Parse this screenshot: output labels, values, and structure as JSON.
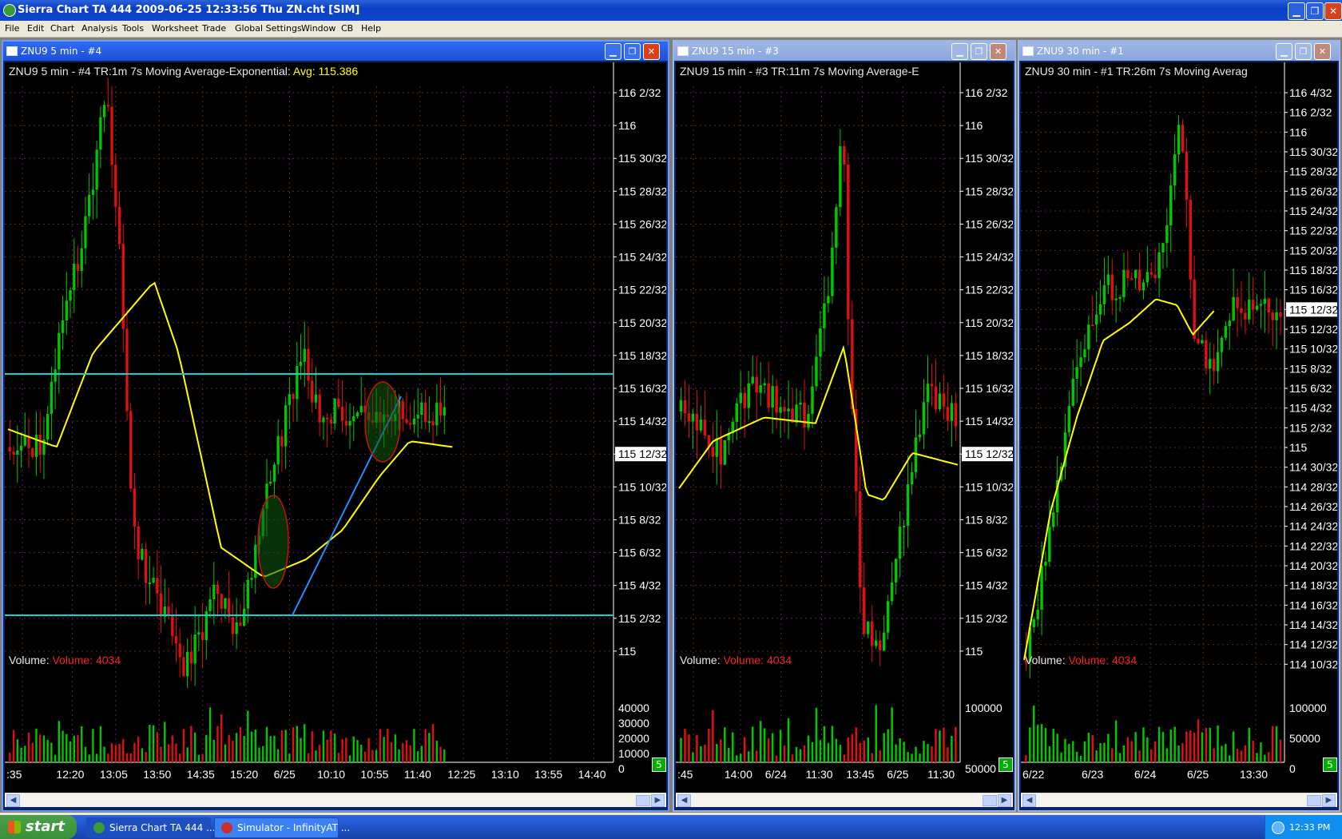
{
  "app": {
    "title": "Sierra Chart TA 444   2009-06-25  12:33:56  Thu    ZN.cht [SIM]"
  },
  "menu": [
    "File",
    "Edit",
    "Chart",
    "Analysis",
    "Tools",
    "Worksheet",
    "Trade",
    "Global Settings",
    "Window",
    "CB",
    "Help"
  ],
  "colors": {
    "background": "#000000",
    "grid": "#5a1f5a",
    "up_candle": "#00c800",
    "down_candle": "#e01010",
    "moving_average": "#ffff00",
    "horizontal_line": "#00d8d8",
    "trendline": "#1e90ff",
    "ellipse_fill": "#0e5a0e",
    "ellipse_edge": "#c81010",
    "axis_text": "#ffffff",
    "volume_value": "#ff2020"
  },
  "windows": [
    {
      "title": "ZNU9  5 min  - #4",
      "header_text": "ZNU9  5 min  - #4  TR:1m 7s  Moving Average-Exponential:",
      "avg_text": "Avg: 115.386",
      "volume_label": "Volume:",
      "volume_value": "Volume: 4034",
      "last_price_label": "115 12/32",
      "badge": "5",
      "price_labels": [
        "116 2/32",
        "116",
        "115 30/32",
        "115 28/32",
        "115 26/32",
        "115 24/32",
        "115 22/32",
        "115 20/32",
        "115 18/32",
        "115 16/32",
        "115 14/32",
        "115 12/32",
        "115 10/32",
        "115 8/32",
        "115 6/32",
        "115 4/32",
        "115 2/32",
        "115"
      ],
      "volume_labels": [
        "40000",
        "30000",
        "20000",
        "10000",
        "0"
      ],
      "time_labels": [
        ":35",
        "12:20",
        "13:05",
        "13:50",
        "14:35",
        "15:20",
        "6/25",
        "10:10",
        "10:55",
        "11:40",
        "12:25",
        "13:10",
        "13:55",
        "14:40"
      ]
    },
    {
      "title": "ZNU9  15 min  - #3",
      "header_text": "ZNU9  15 min  - #3  TR:11m 7s  Moving Average-E",
      "avg_text": "",
      "volume_label": "Volume:",
      "volume_value": "Volume: 4034",
      "last_price_label": "115 12/32",
      "badge": "5",
      "price_labels": [
        "116 2/32",
        "116",
        "115 30/32",
        "115 28/32",
        "115 26/32",
        "115 24/32",
        "115 22/32",
        "115 20/32",
        "115 18/32",
        "115 16/32",
        "115 14/32",
        "115 12/32",
        "115 10/32",
        "115 8/32",
        "115 6/32",
        "115 4/32",
        "115 2/32",
        "115"
      ],
      "volume_labels": [
        "100000",
        "50000"
      ],
      "time_labels": [
        ":45",
        "14:00",
        "6/24",
        "11:30",
        "13:45",
        "6/25",
        "11:30"
      ]
    },
    {
      "title": "ZNU9  30 min  - #1",
      "header_text": "ZNU9  30 min  - #1  TR:26m 7s  Moving Averag",
      "avg_text": "",
      "volume_label": "Volume:",
      "volume_value": "Volume: 4034",
      "last_price_label": "115 12/32",
      "badge": "5",
      "price_labels": [
        "116 4/32",
        "116 2/32",
        "116",
        "115 30/32",
        "115 28/32",
        "115 26/32",
        "115 24/32",
        "115 22/32",
        "115 20/32",
        "115 18/32",
        "115 16/32",
        "115 14/32",
        "115 12/32",
        "115 10/32",
        "115 8/32",
        "115 6/32",
        "115 4/32",
        "115 2/32",
        "115",
        "114 30/32",
        "114 28/32",
        "114 26/32",
        "114 24/32",
        "114 22/32",
        "114 20/32",
        "114 18/32",
        "114 16/32",
        "114 14/32",
        "114 12/32",
        "114 10/32"
      ],
      "volume_labels": [
        "100000",
        "50000",
        "0"
      ],
      "time_labels": [
        "6/22",
        "6/23",
        "6/24",
        "6/25",
        "13:30"
      ]
    }
  ],
  "taskbar": {
    "start_label": "start",
    "items": [
      "Sierra Chart TA 444 ...",
      "Simulator - InfinityAT ..."
    ],
    "clock": "12:33 PM"
  },
  "icons": [
    "app-globe-icon",
    "minimize-icon",
    "restore-icon",
    "close-icon",
    "window-icon",
    "scroll-left-icon",
    "scroll-right-icon",
    "start-flag-icon",
    "tray-network-icon"
  ]
}
